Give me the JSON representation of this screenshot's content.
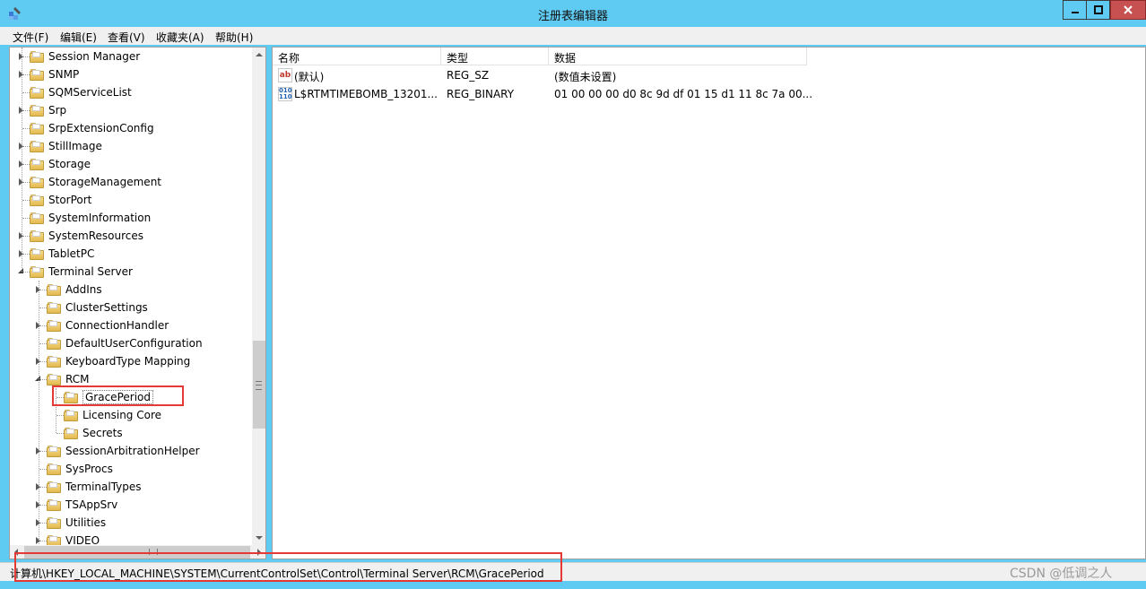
{
  "window": {
    "title": "注册表编辑器",
    "accent": "#5fcaf2",
    "controls": {
      "minimize": "minimize-icon",
      "maximize": "maximize-icon",
      "close": "close-icon"
    }
  },
  "menu": [
    "文件(F)",
    "编辑(E)",
    "查看(V)",
    "收藏夹(A)",
    "帮助(H)"
  ],
  "tree": [
    {
      "label": "Session Manager",
      "level": 0,
      "expander": "closed"
    },
    {
      "label": "SNMP",
      "level": 0,
      "expander": "closed"
    },
    {
      "label": "SQMServiceList",
      "level": 0,
      "expander": "none"
    },
    {
      "label": "Srp",
      "level": 0,
      "expander": "closed"
    },
    {
      "label": "SrpExtensionConfig",
      "level": 0,
      "expander": "none"
    },
    {
      "label": "StillImage",
      "level": 0,
      "expander": "closed"
    },
    {
      "label": "Storage",
      "level": 0,
      "expander": "closed"
    },
    {
      "label": "StorageManagement",
      "level": 0,
      "expander": "closed"
    },
    {
      "label": "StorPort",
      "level": 0,
      "expander": "none"
    },
    {
      "label": "SystemInformation",
      "level": 0,
      "expander": "none"
    },
    {
      "label": "SystemResources",
      "level": 0,
      "expander": "closed"
    },
    {
      "label": "TabletPC",
      "level": 0,
      "expander": "closed"
    },
    {
      "label": "Terminal Server",
      "level": 0,
      "expander": "open"
    },
    {
      "label": "AddIns",
      "level": 1,
      "expander": "closed"
    },
    {
      "label": "ClusterSettings",
      "level": 1,
      "expander": "none"
    },
    {
      "label": "ConnectionHandler",
      "level": 1,
      "expander": "closed"
    },
    {
      "label": "DefaultUserConfiguration",
      "level": 1,
      "expander": "none"
    },
    {
      "label": "KeyboardType Mapping",
      "level": 1,
      "expander": "closed"
    },
    {
      "label": "RCM",
      "level": 1,
      "expander": "open"
    },
    {
      "label": "GracePeriod",
      "level": 2,
      "expander": "none",
      "selected": true
    },
    {
      "label": "Licensing Core",
      "level": 2,
      "expander": "none"
    },
    {
      "label": "Secrets",
      "level": 2,
      "expander": "none"
    },
    {
      "label": "SessionArbitrationHelper",
      "level": 1,
      "expander": "closed"
    },
    {
      "label": "SysProcs",
      "level": 1,
      "expander": "none"
    },
    {
      "label": "TerminalTypes",
      "level": 1,
      "expander": "closed"
    },
    {
      "label": "TSAppSrv",
      "level": 1,
      "expander": "closed"
    },
    {
      "label": "Utilities",
      "level": 1,
      "expander": "closed"
    },
    {
      "label": "VIDEO",
      "level": 1,
      "expander": "closed"
    }
  ],
  "columns": {
    "name": "名称",
    "type": "类型",
    "data": "数据"
  },
  "values": [
    {
      "icon": "string-value-icon",
      "badge": "ab",
      "name": "(默认)",
      "type": "REG_SZ",
      "data": "(数值未设置)"
    },
    {
      "icon": "binary-value-icon",
      "badge": "010 110",
      "name": "L$RTMTIMEBOMB_13201...",
      "type": "REG_BINARY",
      "data": "01 00 00 00 d0 8c 9d df 01 15 d1 11 8c 7a 00..."
    }
  ],
  "status": {
    "path": "计算机\\HKEY_LOCAL_MACHINE\\SYSTEM\\CurrentControlSet\\Control\\Terminal Server\\RCM\\GracePeriod"
  },
  "watermark": "CSDN @低调之人",
  "highlight_color": "#e53935"
}
